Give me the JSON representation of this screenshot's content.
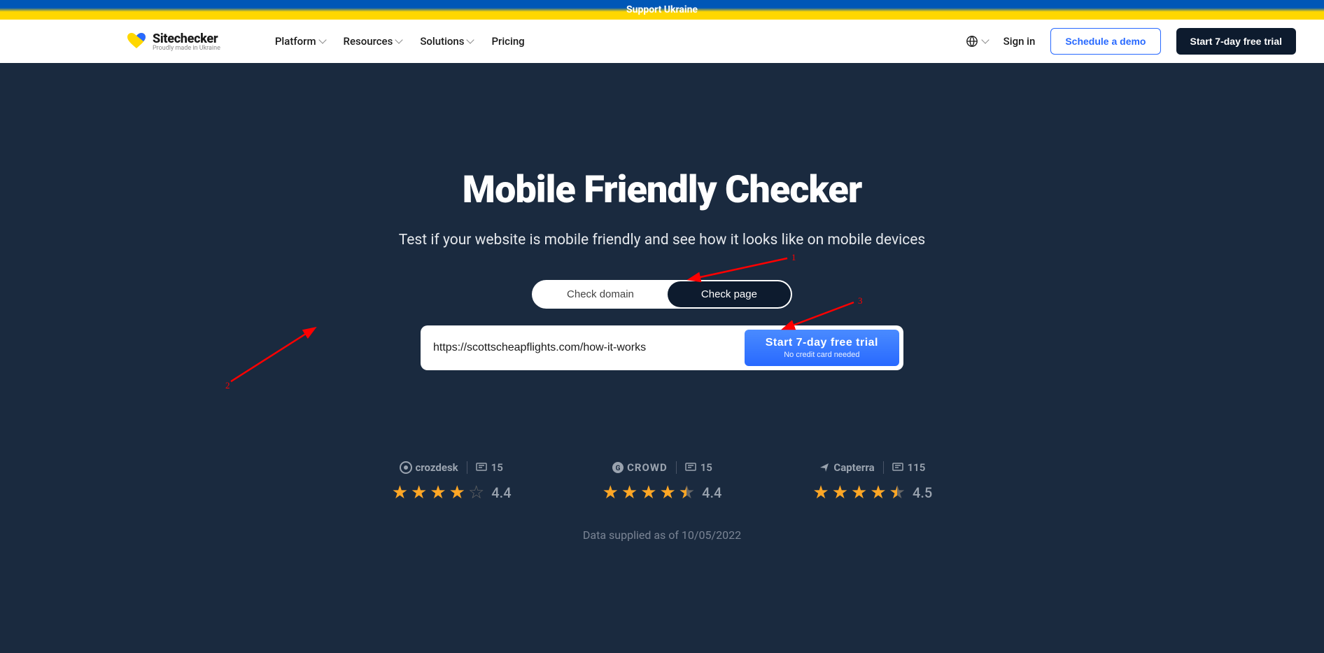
{
  "banner": {
    "text": "Support Ukraine"
  },
  "logo": {
    "name": "Sitechecker",
    "tagline": "Proudly made in Ukraine"
  },
  "nav": {
    "platform": "Platform",
    "resources": "Resources",
    "solutions": "Solutions",
    "pricing": "Pricing"
  },
  "header": {
    "sign_in": "Sign in",
    "schedule": "Schedule a demo",
    "trial": "Start 7-day free trial"
  },
  "hero": {
    "title": "Mobile Friendly Checker",
    "subtitle": "Test if your website is mobile friendly and see how it looks like on mobile devices"
  },
  "toggle": {
    "domain": "Check domain",
    "page": "Check page"
  },
  "input": {
    "value": "https://scottscheapflights.com/how-it-works"
  },
  "cta": {
    "main": "Start 7-day free trial",
    "sub": "No credit card needed"
  },
  "ratings": {
    "crozdesk": {
      "name": "crozdesk",
      "reviews": "15",
      "score": "4.4"
    },
    "crowd": {
      "name": "CROWD",
      "reviews": "15",
      "score": "4.4"
    },
    "capterra": {
      "name": "Capterra",
      "reviews": "115",
      "score": "4.5"
    }
  },
  "data_note": "Data supplied as of 10/05/2022",
  "annotations": {
    "a1": "1",
    "a2": "2",
    "a3": "3"
  }
}
